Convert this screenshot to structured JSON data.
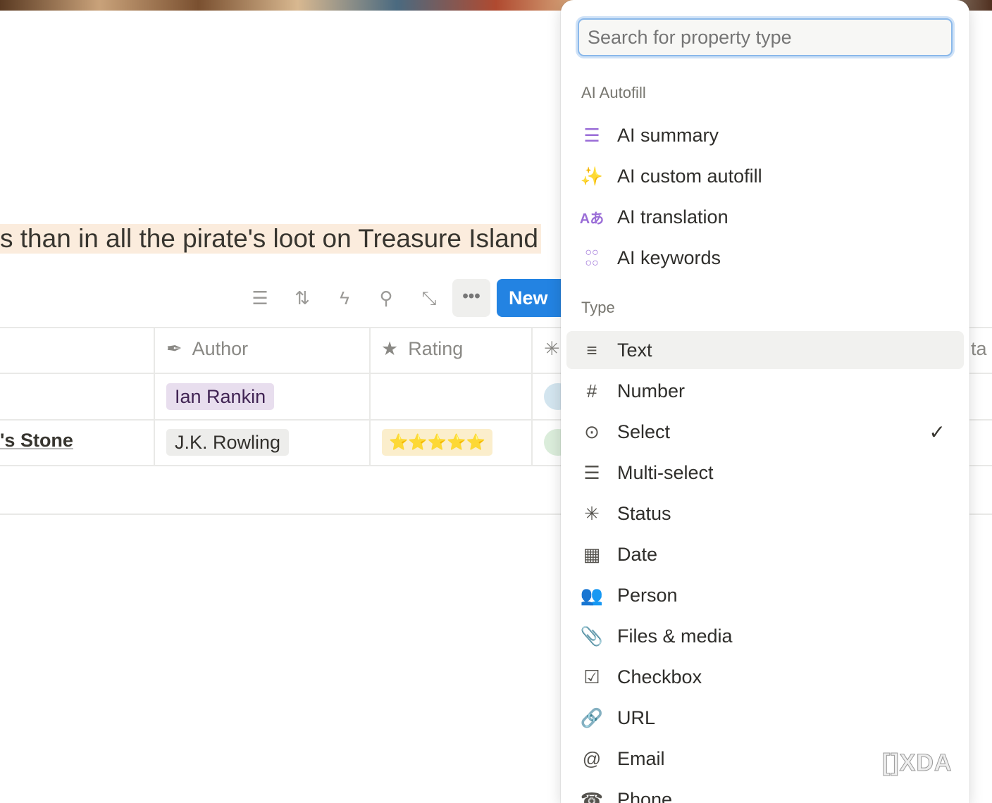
{
  "page": {
    "quote": "s than in all the pirate's loot on Treasure Island"
  },
  "toolbar": {
    "icons": [
      "filter-icon",
      "sort-icon",
      "lightning-icon",
      "search-icon",
      "expand-icon"
    ],
    "more": "•••",
    "new_label": "New"
  },
  "table": {
    "columns": [
      {
        "label": "Author",
        "icon": "pen-icon"
      },
      {
        "label": "Rating",
        "icon": "star-icon"
      }
    ],
    "partial_column": "ta",
    "rows": [
      {
        "title": "",
        "author": "Ian Rankin",
        "rating": ""
      },
      {
        "title": "'s Stone",
        "author": "J.K. Rowling",
        "rating": "⭐⭐⭐⭐⭐"
      }
    ]
  },
  "menu": {
    "search_placeholder": "Search for property type",
    "ai_header": "AI Autofill",
    "ai_items": [
      {
        "label": "AI summary",
        "icon": "ai-summary-icon"
      },
      {
        "label": "AI custom autofill",
        "icon": "magic-wand-icon"
      },
      {
        "label": "AI translation",
        "icon": "translate-icon"
      },
      {
        "label": "AI keywords",
        "icon": "keywords-icon"
      }
    ],
    "type_header": "Type",
    "type_items": [
      {
        "label": "Text",
        "icon": "text-icon",
        "glyph": "≡",
        "highlighted": true
      },
      {
        "label": "Number",
        "icon": "hash-icon",
        "glyph": "#"
      },
      {
        "label": "Select",
        "icon": "select-icon",
        "glyph": "⊙",
        "selected": true
      },
      {
        "label": "Multi-select",
        "icon": "list-icon",
        "glyph": "☰"
      },
      {
        "label": "Status",
        "icon": "status-icon",
        "glyph": "✳"
      },
      {
        "label": "Date",
        "icon": "calendar-icon",
        "glyph": "▦"
      },
      {
        "label": "Person",
        "icon": "people-icon",
        "glyph": "👥"
      },
      {
        "label": "Files & media",
        "icon": "paperclip-icon",
        "glyph": "📎"
      },
      {
        "label": "Checkbox",
        "icon": "checkbox-icon",
        "glyph": "☑"
      },
      {
        "label": "URL",
        "icon": "link-icon",
        "glyph": "🔗"
      },
      {
        "label": "Email",
        "icon": "at-icon",
        "glyph": "@"
      },
      {
        "label": "Phone",
        "icon": "phone-icon",
        "glyph": "☎"
      }
    ],
    "check": "✓"
  },
  "watermark": "XDA",
  "colors": {
    "accent": "#2383e2",
    "quote_highlight": "#fbecdd",
    "ai_icon": "#9a6dd7"
  }
}
